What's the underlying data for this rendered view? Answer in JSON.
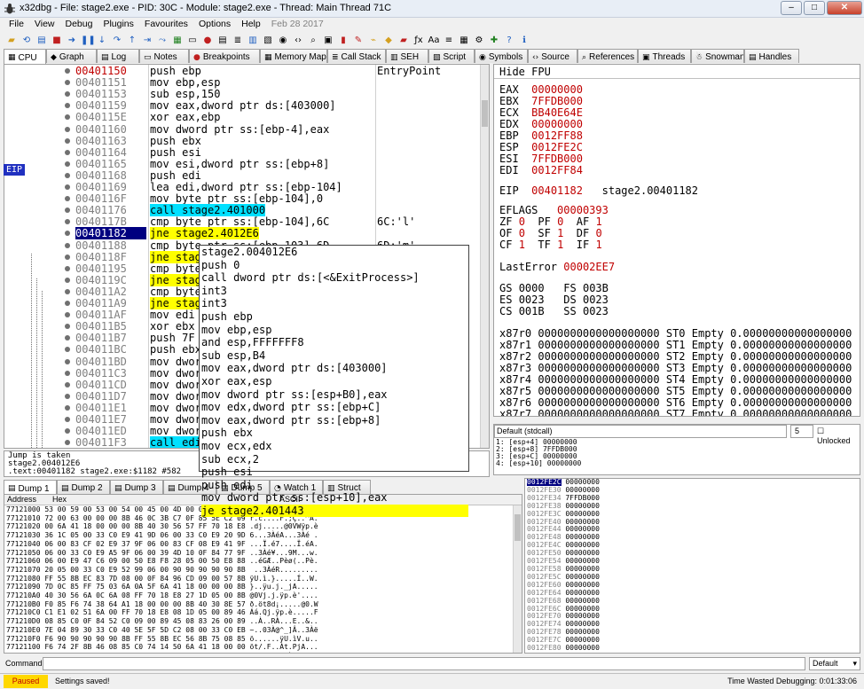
{
  "window": {
    "title": "x32dbg - File: stage2.exe - PID: 30C - Module: stage2.exe - Thread: Main Thread 71C"
  },
  "menu": [
    "File",
    "View",
    "Debug",
    "Plugins",
    "Favourites",
    "Options",
    "Help"
  ],
  "menu_date": "Feb 28 2017",
  "tabs": [
    "CPU",
    "Graph",
    "Log",
    "Notes",
    "Breakpoints",
    "Memory Map",
    "Call Stack",
    "SEH",
    "Script",
    "Symbols",
    "Source",
    "References",
    "Threads",
    "Snowman",
    "Handles"
  ],
  "disasm": [
    {
      "addr": "00401150",
      "ins": "push ebp",
      "cmt": "EntryPoint",
      "cur": true
    },
    {
      "addr": "00401151",
      "ins": "mov ebp,esp"
    },
    {
      "addr": "00401153",
      "ins": "sub esp,150"
    },
    {
      "addr": "00401159",
      "ins": "mov eax,dword ptr ds:[403000]"
    },
    {
      "addr": "0040115E",
      "ins": "xor eax,ebp"
    },
    {
      "addr": "00401160",
      "ins": "mov dword ptr ss:[ebp-4],eax"
    },
    {
      "addr": "00401163",
      "ins": "push ebx"
    },
    {
      "addr": "00401164",
      "ins": "push esi"
    },
    {
      "addr": "00401165",
      "ins": "mov esi,dword ptr ss:[ebp+8]"
    },
    {
      "addr": "00401168",
      "ins": "push edi"
    },
    {
      "addr": "00401169",
      "ins": "lea edi,dword ptr ss:[ebp-104]"
    },
    {
      "addr": "0040116F",
      "ins": "mov byte ptr ss:[ebp-104],0"
    },
    {
      "addr": "00401176",
      "ins": "call stage2.401000",
      "kind": "call"
    },
    {
      "addr": "0040117B",
      "ins": "cmp byte ptr ss:[ebp-104],6C",
      "cmt": "6C:'l'"
    },
    {
      "addr": "00401182",
      "ins": "jne stage2.4012E6",
      "kind": "jne",
      "eip": true
    },
    {
      "addr": "00401188",
      "ins": "cmp byte ptr ss:[ebp-103],6D",
      "cmt": "6D:'m'"
    },
    {
      "addr": "0040118F",
      "ins": "jne stag",
      "kind": "jne"
    },
    {
      "addr": "00401195",
      "ins": "cmp byte"
    },
    {
      "addr": "0040119C",
      "ins": "jne stag",
      "kind": "jne"
    },
    {
      "addr": "004011A2",
      "ins": "cmp byte"
    },
    {
      "addr": "004011A9",
      "ins": "jne stag",
      "kind": "jne"
    },
    {
      "addr": "004011AF",
      "ins": "mov edi"
    },
    {
      "addr": "004011B5",
      "ins": "xor ebx"
    },
    {
      "addr": "004011B7",
      "ins": "push 7F"
    },
    {
      "addr": "004011BC",
      "ins": "push ebx"
    },
    {
      "addr": "004011BD",
      "ins": "mov dwor"
    },
    {
      "addr": "004011C3",
      "ins": "mov dwor"
    },
    {
      "addr": "004011CD",
      "ins": "mov dwor"
    },
    {
      "addr": "004011D7",
      "ins": "mov dwor"
    },
    {
      "addr": "004011E1",
      "ins": "mov dwor"
    },
    {
      "addr": "004011E7",
      "ins": "mov dwor"
    },
    {
      "addr": "004011ED",
      "ins": "mov dwor"
    },
    {
      "addr": "004011F3",
      "ins": "call edi",
      "kind": "call"
    }
  ],
  "eip_label": "EIP",
  "popup": [
    "stage2.004012E6",
    "push 0",
    "call dword ptr ds:[<&ExitProcess>]",
    "int3",
    "int3",
    "push ebp",
    "mov ebp,esp",
    "and esp,FFFFFFF8",
    "sub esp,B4",
    "mov eax,dword ptr ds:[403000]",
    "xor eax,esp",
    "mov dword ptr ss:[esp+B0],eax",
    "mov edx,dword ptr ss:[ebp+C]",
    "mov eax,dword ptr ss:[ebp+8]",
    "push ebx",
    "mov ecx,edx",
    "sub ecx,2",
    "push esi",
    "push edi",
    "mov dword ptr ss:[esp+10],eax",
    "je stage2.401443"
  ],
  "info": [
    "Jump is taken",
    "stage2.004012E6",
    ".text:00401182 stage2.exe:$1182 #582"
  ],
  "regs_header": "Hide FPU",
  "regs": [
    [
      "EAX",
      "00000000",
      ""
    ],
    [
      "EBX",
      "7FFDB000",
      ""
    ],
    [
      "ECX",
      "BB40E64E",
      ""
    ],
    [
      "EDX",
      "00000000",
      ""
    ],
    [
      "EBP",
      "0012FF88",
      ""
    ],
    [
      "ESP",
      "0012FE2C",
      ""
    ],
    [
      "ESI",
      "7FFDB000",
      ""
    ],
    [
      "EDI",
      "0012FF84",
      ""
    ]
  ],
  "eip_reg": {
    "name": "EIP",
    "value": "00401182",
    "sym": "stage2.00401182"
  },
  "eflags": {
    "name": "EFLAGS",
    "value": "00000393"
  },
  "flags": [
    [
      "ZF",
      "0",
      "PF",
      "0",
      "AF",
      "1"
    ],
    [
      "OF",
      "0",
      "SF",
      "1",
      "DF",
      "0"
    ],
    [
      "CF",
      "1",
      "TF",
      "1",
      "IF",
      "1"
    ]
  ],
  "lasterror": {
    "name": "LastError",
    "value": "00002EE7"
  },
  "segs": [
    [
      "GS",
      "0000",
      "FS",
      "003B"
    ],
    [
      "ES",
      "0023",
      "DS",
      "0023"
    ],
    [
      "CS",
      "001B",
      "SS",
      "0023"
    ]
  ],
  "fpu": [
    "x87r0 0000000000000000000 ST0 Empty 0.00000000000000000",
    "x87r1 0000000000000000000 ST1 Empty 0.00000000000000000",
    "x87r2 0000000000000000000 ST2 Empty 0.00000000000000000",
    "x87r3 0000000000000000000 ST3 Empty 0.00000000000000000",
    "x87r4 0000000000000000000 ST4 Empty 0.00000000000000000",
    "x87r5 0000000000000000000 ST5 Empty 0.00000000000000000",
    "x87r6 0000000000000000000 ST6 Empty 0.00000000000000000",
    "x87r7 0000000000000000000 ST7 Empty 0.00000000000000000"
  ],
  "callconv": "Default (stdcall)",
  "argcount": "5",
  "unlocked": "Unlocked",
  "args": "1: [esp+4] 00000000\n2: [esp+8] 7FFDB000\n3: [esp+C] 00000000\n4: [esp+10] 00000000",
  "bottom_tabs": [
    "Dump 1",
    "Dump 2",
    "Dump 3",
    "Dump 4",
    "Dump 5",
    "Watch 1",
    "Struct"
  ],
  "dump_headers": {
    "address": "Address",
    "hex": "Hex",
    "ascii": "ASCII"
  },
  "dump": "77121000 53 00 59 00 53 00 54 00 45 00 4D 00 00 00 90 90 S.Y.S.T.E.M.....\n77121010 72 00 63 00 00 00 8B 46 0C 3B C7 0F 85 5E C2 09 r.c....F.;Ç..^Â.\n77121020 00 6A 41 18 00 00 00 8B 40 30 56 57 FF 70 18 E8 .dj.....@0VWÿp.è\n77121030 36 1C 05 00 33 C0 E9 41 9D 06 00 33 C0 E9 20 9D 6...3ÀéA...3Àé .\n77121040 06 00 83 CF 02 E9 37 9F 06 00 83 CF 08 E9 41 9F ...Ï.é7....Ï.éA.\n77121050 06 00 33 C0 E9 A5 9F 06 00 39 4D 10 0F 84 77 9F ..3Àé¥...9M...w.\n77121060 06 00 E9 47 C6 09 00 50 E8 F8 28 05 00 50 E8 88 ..éGÆ..Pèø(..Pè.\n77121070 20 05 00 33 C0 E9 52 99 06 00 90 90 90 90 90 8B  ..3ÀéR.........\n77121080 FF 55 8B EC 83 7D 08 00 0F 84 96 CD 09 00 57 8B ÿU.ì.}.....Í..W.\n77121090 7D 0C 85 FF 75 03 6A 0A 5F 6A 41 18 00 00 00 8B }..ÿu.j._jA.....\n771210A0 40 30 56 6A 0C 6A 08 FF 70 18 E8 27 1D 05 00 8B @0Vj.j.ÿp.è'....\n771210B0 F0 85 F6 74 38 64 A1 18 00 00 00 8B 40 30 8E 57 ð.öt8d¡.....@0.W\n771210C0 C1 E1 02 51 6A 00 FF 70 18 E8 08 1D 05 00 89 46 Áá.Qj.ÿp.è.....F\n771210D0 08 85 C0 0F 84 52 C0 09 00 89 45 08 83 26 00 89 ..À..RÀ...E..&..\n771210E0 7E 04 89 30 33 C0 40 5E 5F 5D C2 08 00 33 C0 EB ~..03À@^_]Â..3Àë\n771210F0 F6 90 90 90 90 90 8B FF 55 8B EC 56 8B 75 08 85 ö......ÿU.ìV.u..\n77121100 F6 74 2F 8B 46 08 85 C0 74 14 50 6A 41 18 00 00 öt/.F..Àt.PjA...\n77121110 00 8B 40 30 6A 00 FF 70 18 E8 4C 1B 05 00 64 A1 ..@0j.ÿp.èL...d¡",
  "stack": [
    [
      "0012FE2C",
      "00000000",
      true
    ],
    [
      "0012FE30",
      "00000000"
    ],
    [
      "0012FE34",
      "7FFDB000"
    ],
    [
      "0012FE38",
      "00000000"
    ],
    [
      "0012FE3C",
      "00000000"
    ],
    [
      "0012FE40",
      "00000000"
    ],
    [
      "0012FE44",
      "00000000"
    ],
    [
      "0012FE48",
      "00000000"
    ],
    [
      "0012FE4C",
      "00000000"
    ],
    [
      "0012FE50",
      "00000000"
    ],
    [
      "0012FE54",
      "00000000"
    ],
    [
      "0012FE58",
      "00000000"
    ],
    [
      "0012FE5C",
      "00000000"
    ],
    [
      "0012FE60",
      "00000000"
    ],
    [
      "0012FE64",
      "00000000"
    ],
    [
      "0012FE68",
      "00000000"
    ],
    [
      "0012FE6C",
      "00000000"
    ],
    [
      "0012FE70",
      "00000000"
    ],
    [
      "0012FE74",
      "00000000"
    ],
    [
      "0012FE78",
      "00000000"
    ],
    [
      "0012FE7C",
      "00000000"
    ],
    [
      "0012FE80",
      "00000000"
    ]
  ],
  "command_label": "Command:",
  "command_mode": "Default",
  "status": {
    "state": "Paused",
    "message": "Settings saved!",
    "time": "Time Wasted Debugging: 0:01:33:06"
  }
}
